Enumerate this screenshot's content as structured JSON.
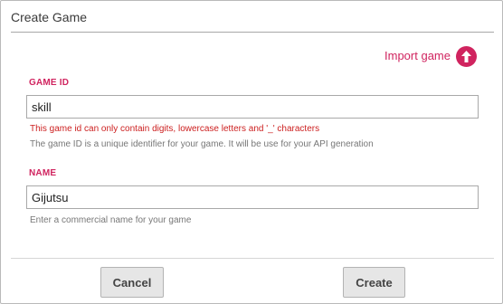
{
  "dialog": {
    "title": "Create Game"
  },
  "import": {
    "label": "Import game",
    "icon": "upload-arrow-icon",
    "color": "#d0245f"
  },
  "fields": {
    "game_id": {
      "label": "GAME ID",
      "value": "skill",
      "error": "This game id can only contain digits, lowercase letters and '_' characters",
      "help": "The game ID is a unique identifier for your game. It will be use for your API generation"
    },
    "name": {
      "label": "NAME",
      "value": "Gijutsu",
      "help": "Enter a commercial name for your game"
    }
  },
  "buttons": {
    "cancel": "Cancel",
    "create": "Create"
  },
  "colors": {
    "accent": "#d0245f",
    "error": "#cc1f1f",
    "button_bg": "#e6e6e6"
  }
}
